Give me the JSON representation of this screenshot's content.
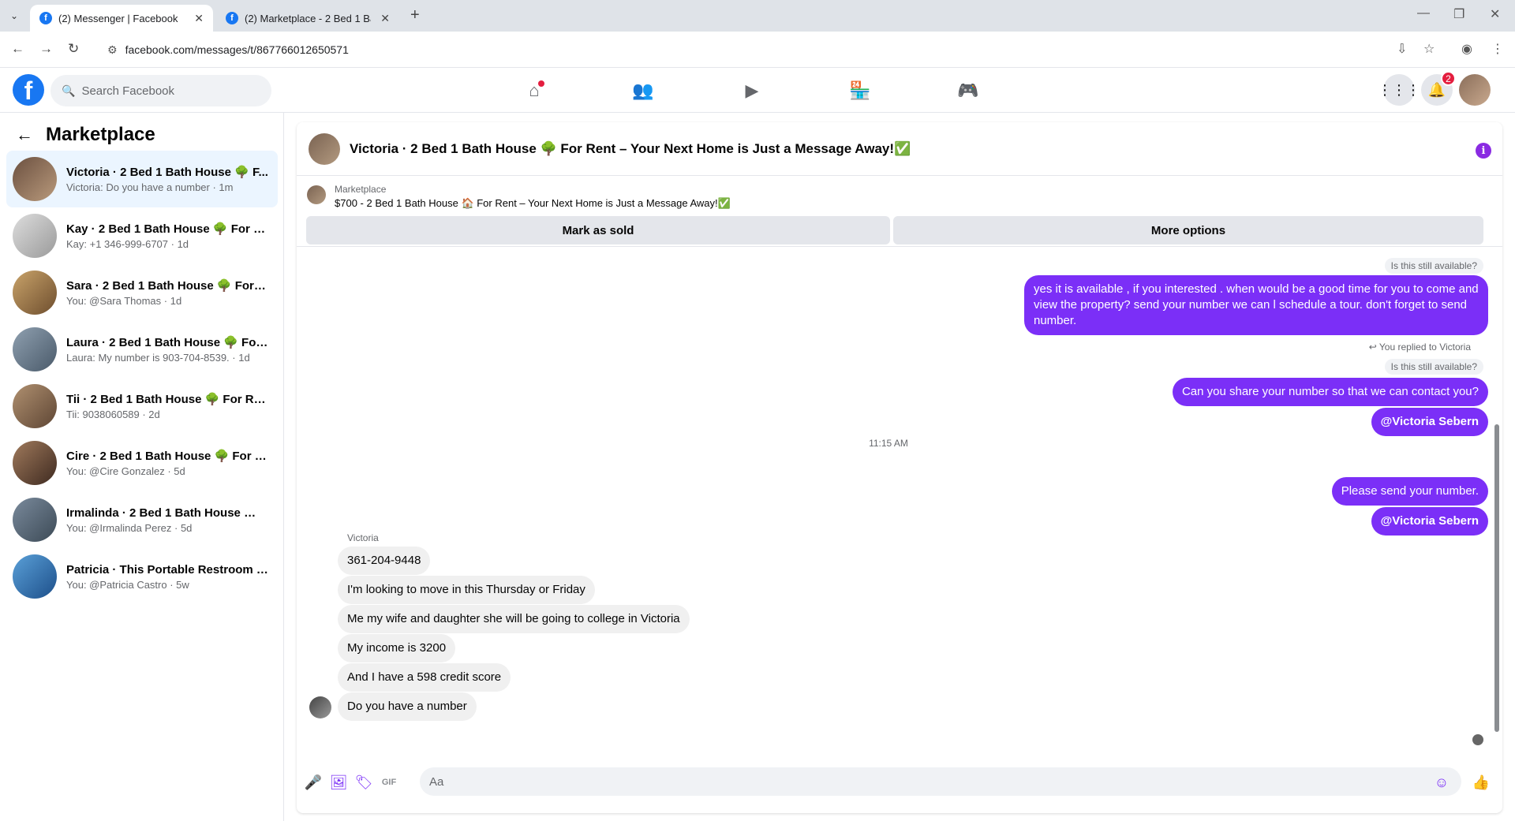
{
  "browser": {
    "tabs": [
      {
        "title": "(2) Messenger | Facebook",
        "active": true
      },
      {
        "title": "(2) Marketplace - 2 Bed 1 Bath",
        "active": false
      }
    ],
    "url": "facebook.com/messages/t/867766012650571"
  },
  "fbnav": {
    "search_placeholder": "Search Facebook",
    "notif_count": "2"
  },
  "sidebar": {
    "title": "Marketplace",
    "conversations": [
      {
        "name": "Victoria · 2 Bed 1 Bath House 🌳 F...",
        "snippet": "Victoria: Do you have a number · 1m",
        "active": true
      },
      {
        "name": "Kay · 2 Bed 1 Bath House 🌳 For R...",
        "snippet": "Kay: +1 346-999-6707 · 1d"
      },
      {
        "name": "Sara · 2 Bed 1 Bath House 🌳 For R...",
        "snippet": "You: @Sara Thomas · 1d"
      },
      {
        "name": "Laura · 2 Bed 1 Bath House 🌳 For ...",
        "snippet": "Laura: My number is 903-704-8539. · 1d"
      },
      {
        "name": "Tii · 2 Bed 1 Bath House 🌳 For Re...",
        "snippet": "Tii: 9038060589 · 2d"
      },
      {
        "name": "Cire · 2 Bed 1 Bath House 🌳 For R...",
        "snippet": "You: @Cire Gonzalez · 5d"
      },
      {
        "name": "Irmalinda · 2 Bed 1 Bath House 🌳 ...",
        "snippet": "You: @Irmalinda Perez · 5d"
      },
      {
        "name": "Patricia · This Portable Restroom w...",
        "snippet": "You: @Patricia Castro · 5w"
      }
    ]
  },
  "chat": {
    "title": "Victoria · 2 Bed 1 Bath House 🌳 For Rent – Your Next Home is Just a Message Away!✅",
    "listing_source": "Marketplace",
    "listing_title": "$700 - 2 Bed 1 Bath House 🏠 For Rent – Your Next Home is Just a Message Away!✅",
    "mark_sold": "Mark as sold",
    "more_options": "More options",
    "quote1": "Is this still available?",
    "out1": "yes it is available , if you interested . when would    be  a good time for you to come and view the  property? send your number we can l schedule  a tour. don't forget to send  number.",
    "replied_note": "You replied to Victoria",
    "quote2": "Is this still available?",
    "out2": "Can you share your number so that we can contact you?",
    "mention1": "@Victoria Sebern",
    "timestamp": "11:15 AM",
    "out3": "Please send your number.",
    "mention2": "@Victoria Sebern",
    "sender_name": "Victoria",
    "in_msgs": [
      "361-204-9448",
      "I'm looking to move in this Thursday or Friday",
      "Me my wife and daughter she will be going to college in Victoria",
      "My income is 3200",
      "And I have a 598 credit score",
      "Do you have a number"
    ],
    "composer_placeholder": "Aa"
  },
  "colors": {
    "accent": "#7b2ff7",
    "fb_blue": "#1877f2"
  }
}
